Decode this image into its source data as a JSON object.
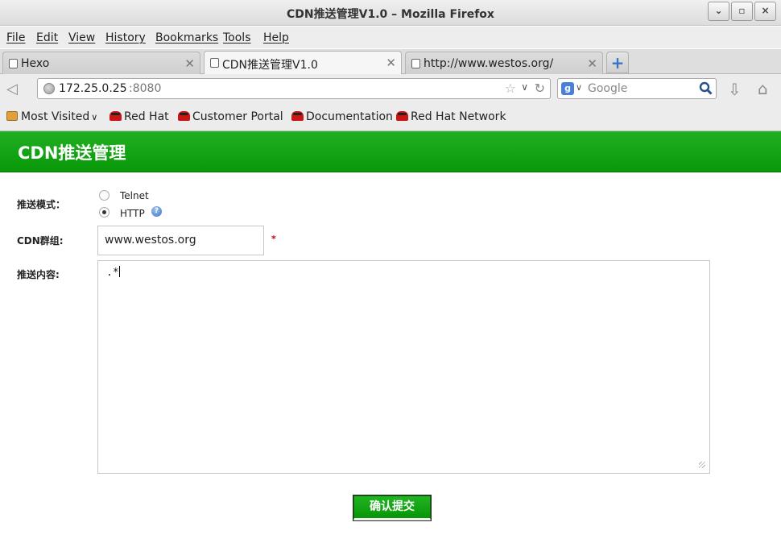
{
  "window": {
    "title": "CDN推送管理V1.0 – Mozilla Firefox",
    "minimize_glyph": "⌄",
    "maximize_glyph": "▫",
    "close_glyph": "×"
  },
  "menu": [
    "File",
    "Edit",
    "View",
    "History",
    "Bookmarks",
    "Tools",
    "Help"
  ],
  "tabs": [
    {
      "label": "Hexo",
      "active": false
    },
    {
      "label": "CDN推送管理V1.0",
      "active": true
    },
    {
      "label": "http://www.westos.org/",
      "active": false
    }
  ],
  "newtab_glyph": "+",
  "urlbar": {
    "host": "172.25.0.25",
    "port": ":8080"
  },
  "search": {
    "engine_letter": "g",
    "placeholder": "Google"
  },
  "bookmarks": [
    "Most Visited",
    "Red Hat",
    "Customer Portal",
    "Documentation",
    "Red Hat Network"
  ],
  "page": {
    "banner_title": "CDN推送管理",
    "mode_label": "推送模式：",
    "mode_options": [
      {
        "label": "Telnet",
        "checked": false
      },
      {
        "label": "HTTP",
        "checked": true
      }
    ],
    "help_glyph": "?",
    "group_label": "CDN群组:",
    "group_value": "www.westos.org",
    "required_mark": "*",
    "content_label": "推送内容:",
    "content_value": ".*",
    "submit_label": "确认提交"
  },
  "colors": {
    "banner_green": "#089808",
    "required_red": "#cc0000"
  }
}
